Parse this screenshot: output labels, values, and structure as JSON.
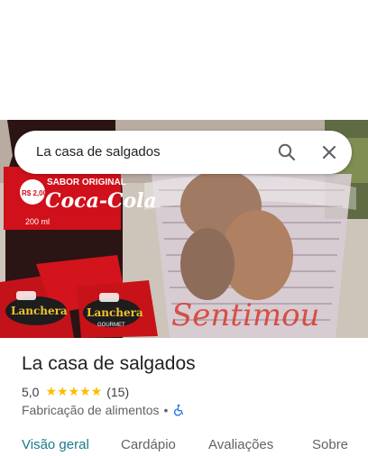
{
  "search": {
    "query": "La casa de salgados"
  },
  "place": {
    "name": "La casa de salgados",
    "rating": "5,0",
    "stars": "★★★★★",
    "reviews": "(15)",
    "category": "Fabricação de alimentos",
    "separator": "•"
  },
  "photo": {
    "bottle_brand": "Coca-Cola",
    "bottle_flavor": "SABOR ORIGINAL",
    "bottle_price": "R$ 2,00",
    "bottle_volume": "200 ml",
    "sachet_brand": "Lanchera",
    "sachet_sub": "GOURMET",
    "cup_writing": "Sentimou"
  },
  "tabs": [
    {
      "label": "Visão geral",
      "active": true
    },
    {
      "label": "Cardápio",
      "active": false
    },
    {
      "label": "Avaliações",
      "active": false
    },
    {
      "label": "Sobre",
      "active": false
    }
  ],
  "colors": {
    "accent": "#1a7a8a",
    "star": "#fbbc04",
    "wheelchair": "#1a73e8"
  },
  "icons": {
    "search": "search-icon",
    "close": "close-icon",
    "accessibility": "wheelchair-icon"
  }
}
